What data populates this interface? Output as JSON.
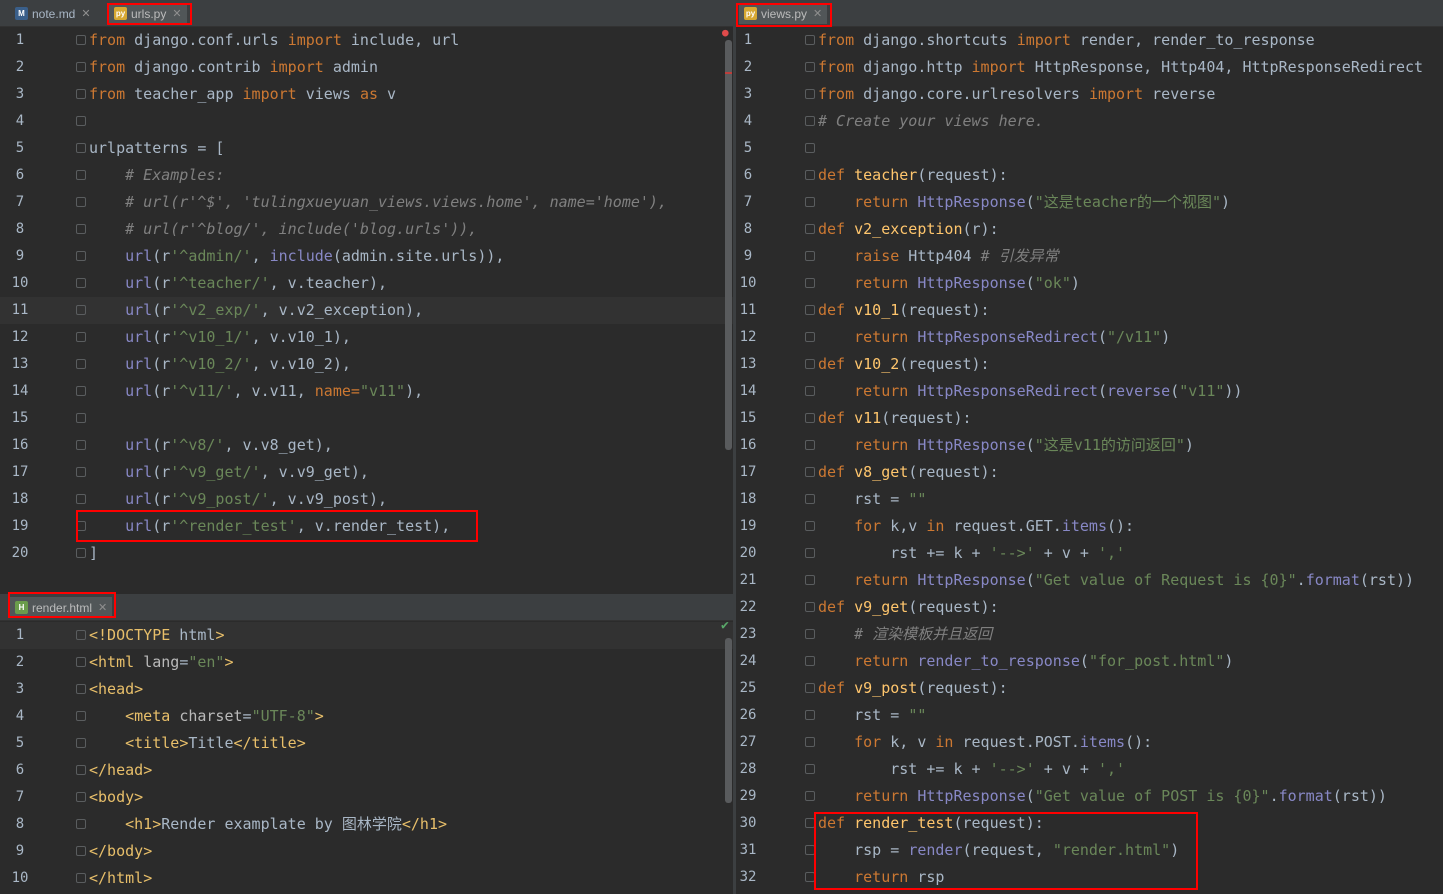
{
  "tabs": {
    "left_top": [
      {
        "label": "note.md",
        "icon": "markdown-file-icon",
        "active": false
      },
      {
        "label": "urls.py",
        "icon": "python-file-icon",
        "active": true
      }
    ],
    "left_bottom": [
      {
        "label": "render.html",
        "icon": "html-file-icon",
        "active": true
      }
    ],
    "right": [
      {
        "label": "views.py",
        "icon": "python-file-icon",
        "active": true
      }
    ]
  },
  "urls_py": {
    "lines": [
      "from django.conf.urls import include, url",
      "from django.contrib import admin",
      "from teacher_app import views as v",
      "",
      "urlpatterns = [",
      "    # Examples:",
      "    # url(r'^$', 'tulingxueyuan_views.views.home', name='home'),",
      "    # url(r'^blog/', include('blog.urls')),",
      "    url(r'^admin/', include(admin.site.urls)),",
      "    url(r'^teacher/', v.teacher),",
      "    url(r'^v2_exp/', v.v2_exception),",
      "    url(r'^v10_1/', v.v10_1),",
      "    url(r'^v10_2/', v.v10_2),",
      "    url(r'^v11/', v.v11, name=\"v11\"),",
      "",
      "    url(r'^v8/', v.v8_get),",
      "    url(r'^v9_get/', v.v9_get),",
      "    url(r'^v9_post/', v.v9_post),",
      "    url(r'^render_test', v.render_test),",
      "]"
    ]
  },
  "render_html": {
    "lines": [
      "<!DOCTYPE html>",
      "<html lang=\"en\">",
      "<head>",
      "    <meta charset=\"UTF-8\">",
      "    <title>Title</title>",
      "</head>",
      "<body>",
      "    <h1>Render examplate by 图林学院</h1>",
      "</body>",
      "</html>"
    ]
  },
  "views_py": {
    "lines": [
      "from django.shortcuts import render, render_to_response",
      "from django.http import HttpResponse, Http404, HttpResponseRedirect",
      "from django.core.urlresolvers import reverse",
      "# Create your views here.",
      "",
      "def teacher(request):",
      "    return HttpResponse(\"这是teacher的一个视图\")",
      "def v2_exception(r):",
      "    raise Http404 # 引发异常",
      "    return HttpResponse(\"ok\")",
      "def v10_1(request):",
      "    return HttpResponseRedirect(\"/v11\")",
      "def v10_2(request):",
      "    return HttpResponseRedirect(reverse(\"v11\"))",
      "def v11(request):",
      "    return HttpResponse(\"这是v11的访问返回\")",
      "def v8_get(request):",
      "    rst = \"\"",
      "    for k,v in request.GET.items():",
      "        rst += k + '-->' + v + ',' ",
      "    return HttpResponse(\"Get value of Request is {0}\".format(rst))",
      "def v9_get(request):",
      "    # 渲染模板并且返回",
      "    return render_to_response(\"for_post.html\")",
      "def v9_post(request):",
      "    rst = \"\"",
      "    for k, v in request.POST.items():",
      "        rst += k + '-->' + v + ','",
      "    return HttpResponse(\"Get value of POST is {0}\".format(rst))",
      "def render_test(request):",
      "    rsp = render(request, \"render.html\")",
      "    return rsp"
    ]
  },
  "colors": {
    "highlight_box": "#ff0000",
    "background": "#2b2b2b"
  }
}
